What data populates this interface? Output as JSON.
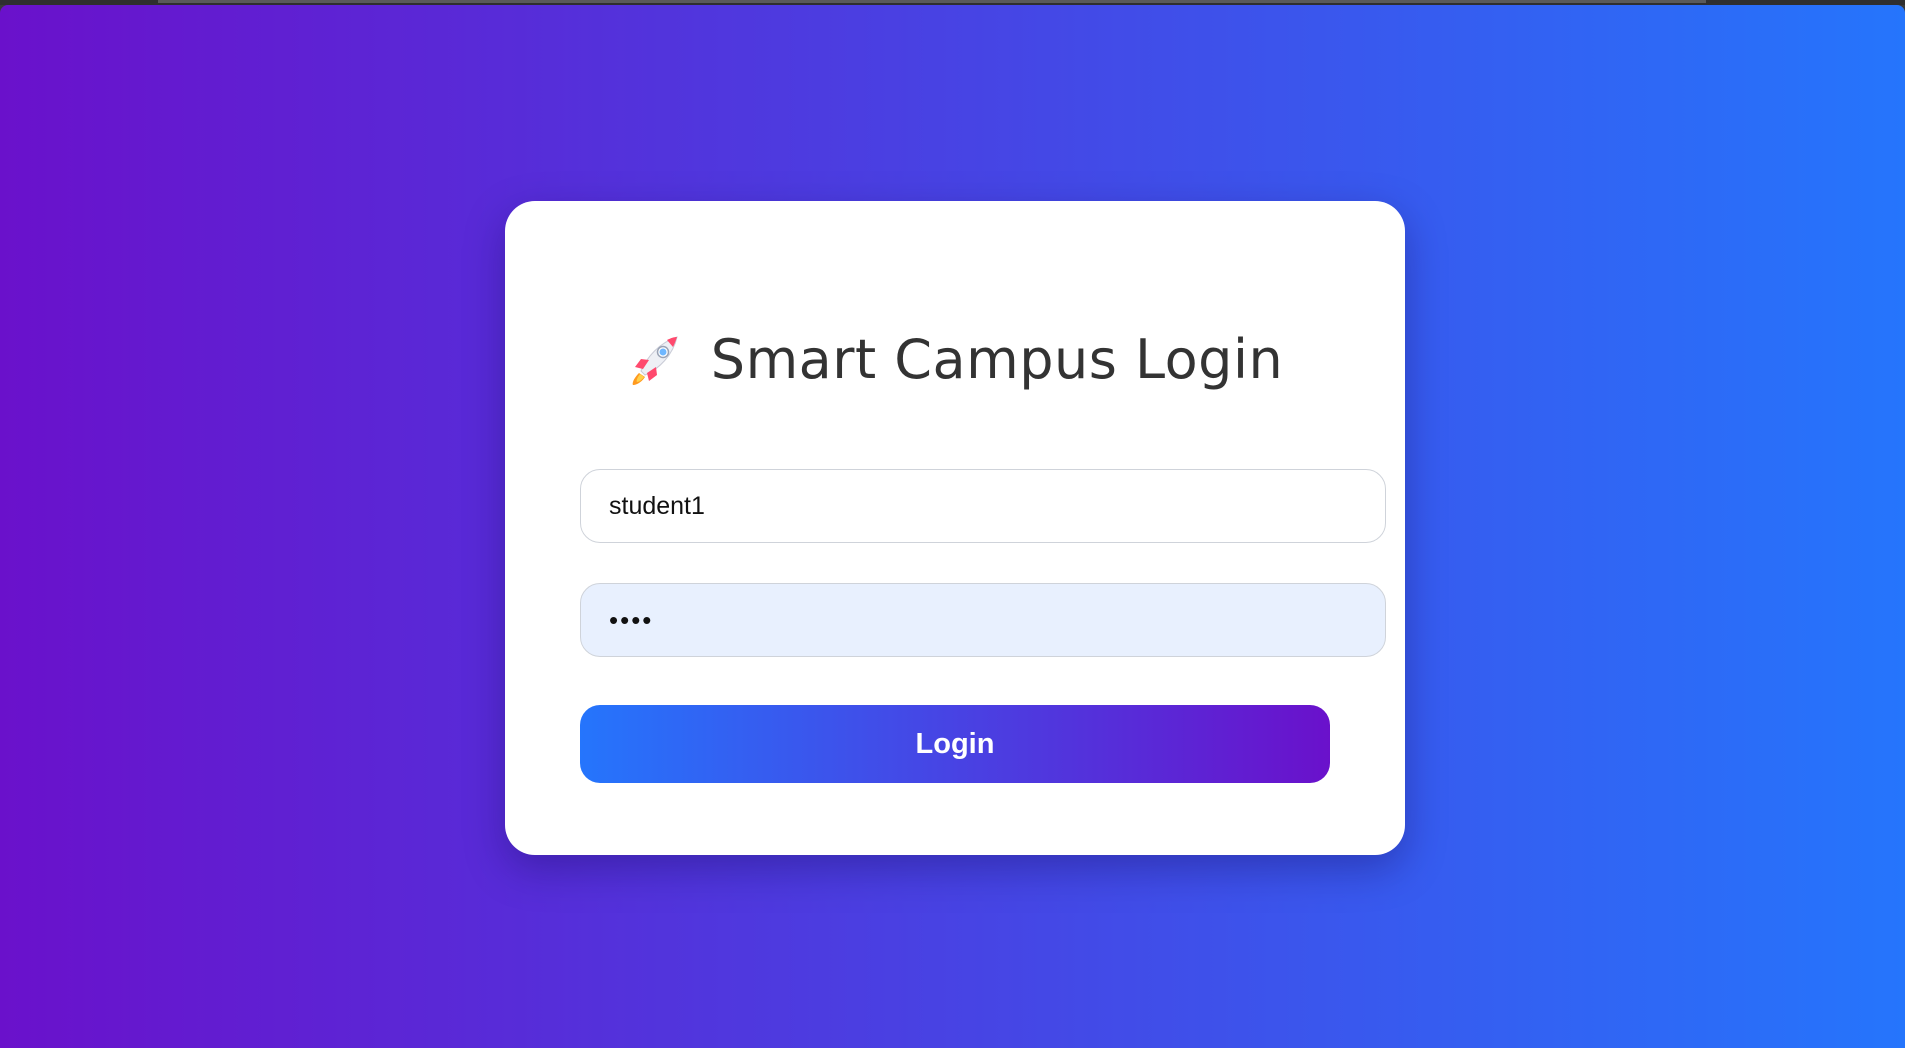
{
  "window": {
    "background_gradient": [
      "#6a11cb",
      "#2575fc"
    ]
  },
  "login_card": {
    "title": "Smart Campus Login",
    "title_icon": "rocket-icon",
    "username": {
      "value": "student1"
    },
    "password": {
      "value": "••••"
    },
    "login_button": {
      "label": "Login",
      "gradient": [
        "#2575fc",
        "#6a11cb"
      ]
    }
  }
}
